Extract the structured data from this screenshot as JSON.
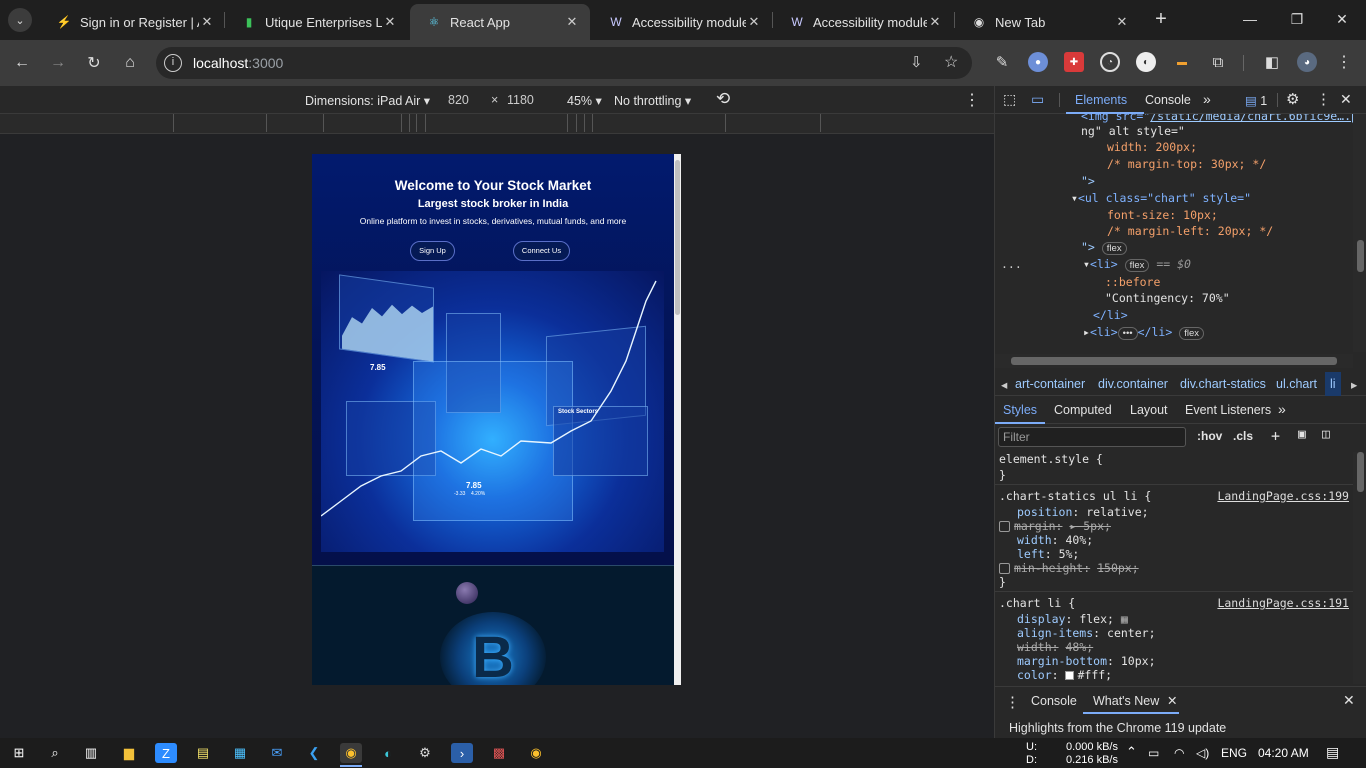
{
  "tabs": [
    {
      "title": "Sign in or Register | A",
      "icon": "stride-icon",
      "active": false
    },
    {
      "title": "Utique Enterprises Ltd",
      "icon": "bar-chart-icon",
      "active": false
    },
    {
      "title": "React App",
      "icon": "react-icon",
      "active": true
    },
    {
      "title": "Accessibility module |",
      "icon": "webflow-icon",
      "active": false
    },
    {
      "title": "Accessibility module |",
      "icon": "webflow-icon",
      "active": false
    },
    {
      "title": "New Tab",
      "icon": "chrome-icon",
      "active": false
    }
  ],
  "address": {
    "host": "localhost",
    "port": ":3000"
  },
  "device": {
    "dimensions_label": "Dimensions: iPad Air",
    "width": "820",
    "times": "×",
    "height": "1180",
    "zoom": "45%",
    "throttling": "No throttling"
  },
  "page": {
    "title": "Welcome to Your Stock Market",
    "subtitle": "Largest stock broker in India",
    "tagline": "Online platform to invest in stocks, derivatives, mutual funds, and more",
    "signup": "Sign Up",
    "connect": "Connect Us",
    "chart_numbers": {
      "a": "7.85",
      "b": "7.85",
      "c": "-3.33",
      "d": "4.20%"
    },
    "sector_label": "Stock Sectors"
  },
  "devtools": {
    "tabs": {
      "elements": "Elements",
      "console": "Console",
      "issues_count": "1"
    },
    "breadcrumbs": [
      "art-container",
      "div.container",
      "div.chart-statics",
      "ul.chart",
      "li"
    ],
    "style_tabs": [
      "Styles",
      "Computed",
      "Layout",
      "Event Listeners"
    ],
    "filter_placeholder": "Filter",
    "hov": ":hov",
    "cls": ".cls",
    "code": {
      "l1_tag": "<img src=\"",
      "l1_link": "/static/media/chart.6bfic9e….p",
      "l2": "ng\" alt style=\"",
      "l3": "width: 200px;",
      "l4": "/* margin-top: 30px; */",
      "l5": "\">",
      "l6_tag": "<ul class=\"chart\" style=\"",
      "l7": "font-size: 10px;",
      "l8": "/* margin-left: 20px; */",
      "l9": "\">",
      "badge_flex": "flex",
      "l10_tag": "<li>",
      "l10_eq": "== $0",
      "l11": "::before",
      "l12": "\"Contingency: 70%\"",
      "l13": "</li>",
      "l14a": "<li>",
      "l14b": "</li>",
      "dots": "•••",
      "side_dots": "..."
    },
    "styles": {
      "element_style": "element.style {",
      "close": "}",
      "rule1_sel": ".chart-statics ul li {",
      "rule1_src": "LandingPage.css:199",
      "rule1_p1": "position",
      "rule1_v1": "relative;",
      "rule1_p2": "margin:",
      "rule1_v2": "▸ 5px;",
      "rule1_p3": "width",
      "rule1_v3": "40%;",
      "rule1_p4": "left",
      "rule1_v4": "5%;",
      "rule1_p5": "min-height:",
      "rule1_v5": "150px;",
      "rule2_sel": ".chart li {",
      "rule2_src": "LandingPage.css:191",
      "rule2_p1": "display",
      "rule2_v1": "flex;",
      "rule2_p2": "align-items",
      "rule2_v2": "center;",
      "rule2_p3": "width:",
      "rule2_v3": "48%;",
      "rule2_p4": "margin-bottom",
      "rule2_v4": "10px;",
      "rule2_p5": "color",
      "rule2_v5": "#fff;"
    },
    "drawer": {
      "console": "Console",
      "whats_new": "What's New",
      "highlight": "Highlights from the Chrome 119 update"
    }
  },
  "taskbar": {
    "net_up_label": "U:",
    "net_up": "0.000 kB/s",
    "net_down_label": "D:",
    "net_down": "0.216 kB/s",
    "lang": "ENG",
    "time": "04:20 AM"
  },
  "colors": {
    "accent": "#7cacf8",
    "page_bg": "#041a2e",
    "hero_top": "#021a6e"
  }
}
